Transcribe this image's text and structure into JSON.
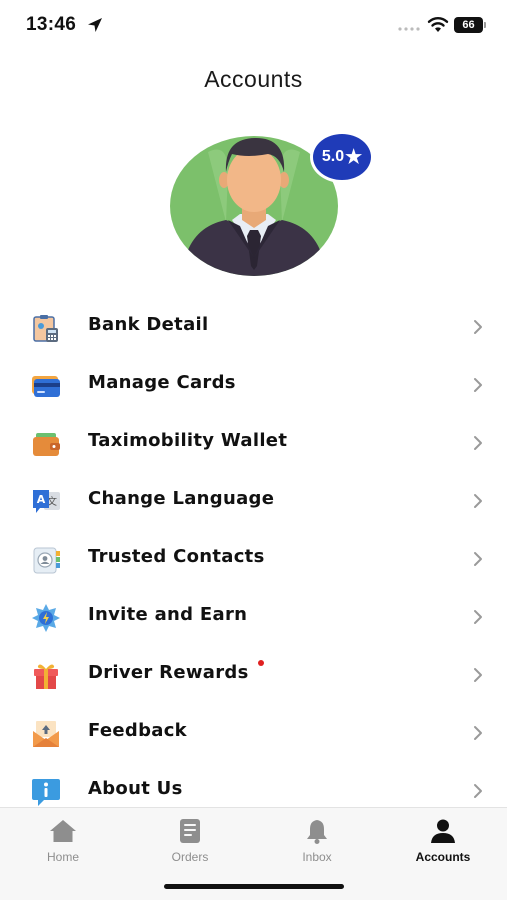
{
  "status_bar": {
    "time": "13:46",
    "battery": "66"
  },
  "header": {
    "title": "Accounts"
  },
  "profile": {
    "rating": "5.0",
    "rating_star": "★"
  },
  "menu": {
    "items": [
      {
        "label": "Bank Detail",
        "icon": "bank-detail-icon"
      },
      {
        "label": "Manage Cards",
        "icon": "credit-card-icon"
      },
      {
        "label": "Taximobility Wallet",
        "icon": "wallet-icon"
      },
      {
        "label": "Change Language",
        "icon": "translate-icon"
      },
      {
        "label": "Trusted Contacts",
        "icon": "contacts-icon"
      },
      {
        "label": "Invite and Earn",
        "icon": "invite-icon"
      },
      {
        "label": "Driver Rewards",
        "icon": "gift-icon",
        "has_notification": true
      },
      {
        "label": "Feedback",
        "icon": "feedback-icon"
      },
      {
        "label": "About Us",
        "icon": "info-icon"
      }
    ]
  },
  "tab_bar": {
    "tabs": [
      {
        "label": "Home",
        "icon": "home-icon",
        "active": false
      },
      {
        "label": "Orders",
        "icon": "orders-icon",
        "active": false
      },
      {
        "label": "Inbox",
        "icon": "bell-icon",
        "active": false
      },
      {
        "label": "Accounts",
        "icon": "person-icon",
        "active": true
      }
    ]
  },
  "colors": {
    "accent": "#1f3bb8",
    "notification": "#e02020",
    "tab_inactive": "#8e8e8e"
  }
}
